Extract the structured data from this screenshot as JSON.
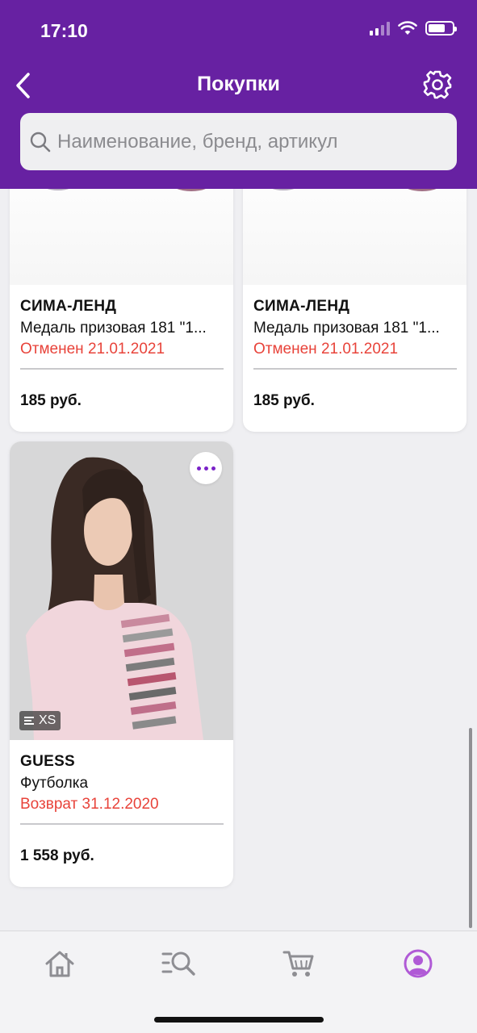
{
  "status_bar": {
    "time": "17:10"
  },
  "header": {
    "title": "Покупки"
  },
  "search": {
    "placeholder": "Наименование, бренд, артикул"
  },
  "purchases": [
    {
      "brand": "СИМА-ЛЕНД",
      "name": "Медаль призовая 181 \"1...",
      "status": "Отменен 21.01.2021",
      "price": "185 руб."
    },
    {
      "brand": "СИМА-ЛЕНД",
      "name": "Медаль призовая 181 \"1...",
      "status": "Отменен 21.01.2021",
      "price": "185 руб."
    },
    {
      "brand": "GUESS",
      "name": "Футболка",
      "status": "Возврат 31.12.2020",
      "price": "1 558 руб.",
      "size": "XS"
    }
  ],
  "tabbar": {
    "items": [
      "home-icon",
      "catalog-search-icon",
      "cart-icon",
      "profile-icon"
    ],
    "active": "profile-icon"
  },
  "colors": {
    "header": "#6721a2",
    "accent": "#7a22c8",
    "status_red": "#e8433a",
    "tab_active": "#b05ad6"
  }
}
